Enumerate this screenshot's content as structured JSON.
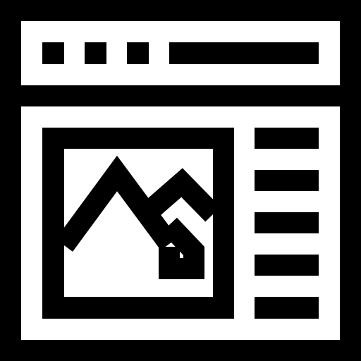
{
  "icon": {
    "name": "webpage-layout-icon",
    "foreground": "#000000",
    "background": "#ffffff"
  },
  "window": {
    "titlebar_dots": 3,
    "sidebar_lines": 5
  }
}
